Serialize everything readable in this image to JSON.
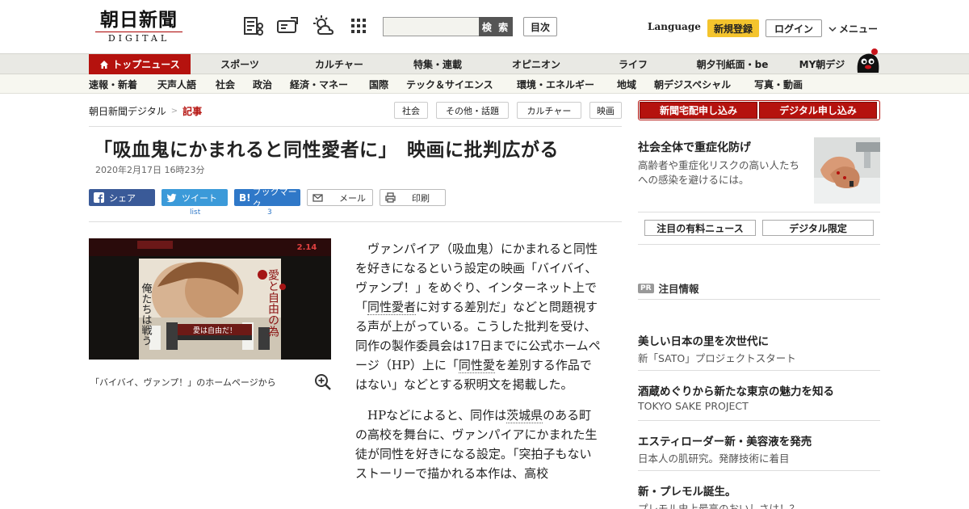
{
  "header": {
    "logo_main": "朝日新聞",
    "logo_sub": "DIGITAL",
    "search_placeholder": "",
    "search_button": "検 索",
    "toc_button": "目次",
    "language": "Language",
    "signup": "新規登録",
    "login": "ログイン",
    "menu": "メニュー",
    "icons": [
      "newspaper-scrap-icon",
      "digital-paper-icon",
      "weather-icon",
      "grid-icon"
    ]
  },
  "nav_primary": [
    "トップニュース",
    "スポーツ",
    "カルチャー",
    "特集・連載",
    "オピニオン",
    "ライフ",
    "朝夕刊紙面・be",
    "MY朝デジ"
  ],
  "nav_secondary": [
    "速報・新着",
    "天声人語",
    "社会",
    "政治",
    "経済・マネー",
    "国際",
    "テック＆サイエンス",
    "環境・エネルギー",
    "地域",
    "朝デジスペシャル",
    "写真・動画"
  ],
  "breadcrumb": {
    "home": "朝日新聞デジタル",
    "separator": ">",
    "current": "記事"
  },
  "tags": [
    "社会",
    "その他・話題",
    "カルチャー",
    "映画"
  ],
  "article": {
    "headline": "「吸血鬼にかまれると同性愛者に」　映画に批判広がる",
    "date": "2020年2月17日 16時23分",
    "share": {
      "facebook": "シェア",
      "twitter": "ツイート",
      "twitter_count": "list",
      "hatena": "ブックマーク",
      "hatena_prefix": "B!",
      "hatena_count": "3",
      "mail": "メール",
      "print": "印刷"
    },
    "photo": {
      "caption": "「バイバイ、ヴァンプ！」のホームページから",
      "poster_release": "2.14",
      "poster_left": "俺たちは戦う",
      "poster_right": "愛と自由の為",
      "poster_center": "愛は自由だ！"
    },
    "p1_a": "ヴァンパイア（吸血鬼）にかまれると同性を好きになるという設定の映画「バイバイ、ヴァンプ！」をめぐり、インターネット上で「",
    "p1_link1": "同性愛者",
    "p1_b": "に対する差別だ」などと問題視する声が上がっている。こうした批判を受け、同作の製作委員会は17日までに公式ホームページ（HP）上に「",
    "p1_link2": "同性愛",
    "p1_c": "を差別する作品ではない」などとする釈明文を掲載した。",
    "p2_a": "HPなどによると、同作は",
    "p2_link1": "茨城県",
    "p2_b": "のある町の高校を舞台に、ヴァンパイアにかまれた生徒が同性を好きになる設定。「突拍子もないストーリーで描かれる本作は、高校"
  },
  "sidebar": {
    "buttons": [
      "新聞宅配申し込み",
      "デジタル申し込み"
    ],
    "feature": {
      "title": "社会全体で重症化防げ",
      "text": "高齢者や重症化リスクの高い人たちへの感染を避けるには。"
    },
    "tabs": [
      "注目の有料ニュース",
      "デジタル限定"
    ],
    "pr_badge": "PR",
    "pr_label": "注目情報",
    "pr_items": [
      {
        "title": "美しい日本の里を次世代に",
        "sub": "新「SATO」プロジェクトスタート"
      },
      {
        "title": "酒蔵めぐりから新たな東京の魅力を知る",
        "sub": "TOKYO SAKE PROJECT"
      },
      {
        "title": "エスティローダー新・美容液を発売",
        "sub": "日本人の肌研究。発酵技術に着目"
      },
      {
        "title": "新・プレモル誕生。",
        "sub": "プレモル史上最高のおいしさは！？"
      }
    ]
  },
  "colors": {
    "brand_red": "#b5120e",
    "signup_yellow": "#f4c42d",
    "facebook": "#3a5a98",
    "twitter": "#3b9ad9",
    "hatena": "#2f78c8"
  }
}
